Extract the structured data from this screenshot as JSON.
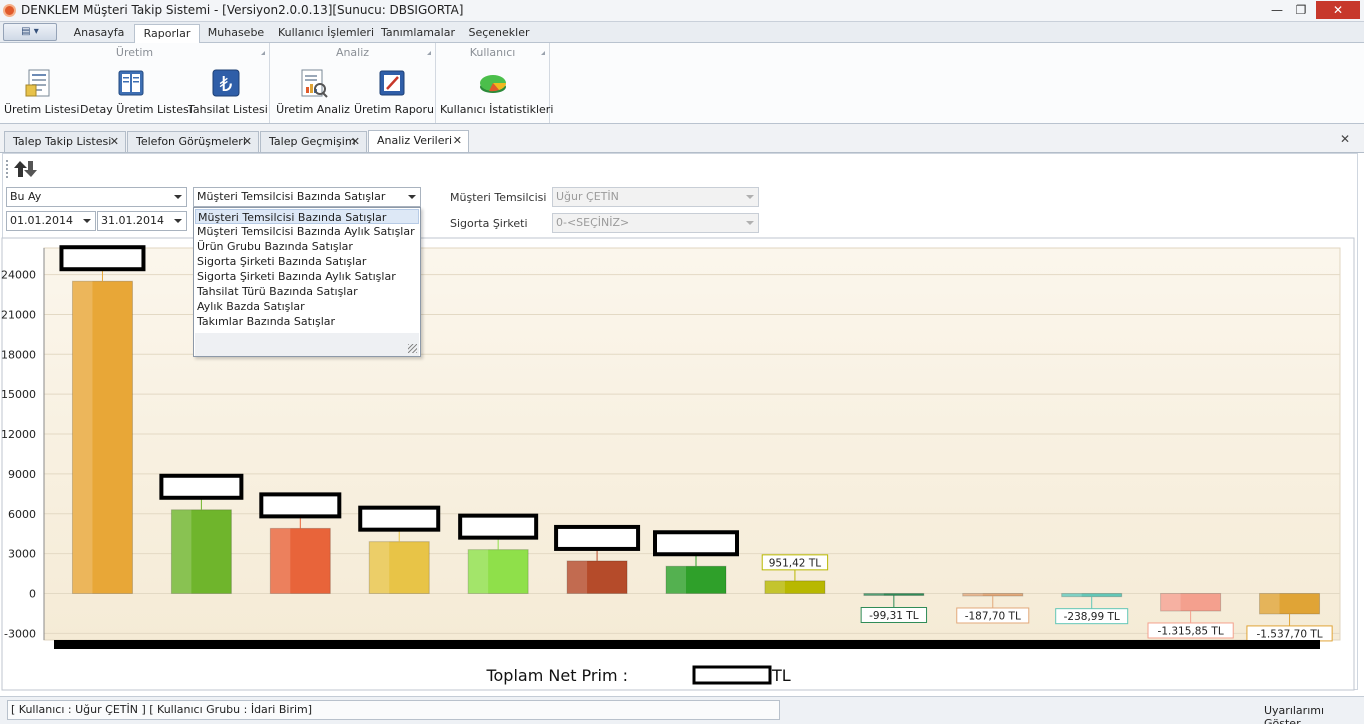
{
  "window": {
    "title": "DENKLEM Müşteri Takip Sistemi - [Versiyon2.0.0.13][Sunucu: DBSIGORTA]",
    "minimize_glyph": "—",
    "maximize_glyph": "❐",
    "close_glyph": "✕"
  },
  "ribbon": {
    "app_menu_glyph": "▤ ▾",
    "tabs": [
      "Anasayfa",
      "Raporlar",
      "Muhasebe",
      "Kullanıcı İşlemleri",
      "Tanımlamalar",
      "Seçenekler"
    ],
    "active_tab": "Raporlar",
    "groups": [
      {
        "title": "Üretim",
        "buttons": [
          {
            "label": "Üretim Listesi",
            "icon": "document-list-icon"
          },
          {
            "label": "Detay Üretim Listesi",
            "icon": "detail-document-icon"
          },
          {
            "label": "Tahsilat Listesi",
            "icon": "lira-icon"
          }
        ]
      },
      {
        "title": "Analiz",
        "buttons": [
          {
            "label": "Üretim Analiz",
            "icon": "analysis-report-icon"
          },
          {
            "label": "Üretim Raporu",
            "icon": "report-pen-icon"
          }
        ]
      },
      {
        "title": "Kullanıcı",
        "buttons": [
          {
            "label": "Kullanıcı İstatistikleri",
            "icon": "pie-chart-icon"
          }
        ]
      }
    ]
  },
  "doc_tabs": [
    {
      "label": "Talep Takip Listesi"
    },
    {
      "label": "Telefon Görüşmeleri"
    },
    {
      "label": "Talep Geçmişim"
    },
    {
      "label": "Analiz Verileri"
    }
  ],
  "doc_tab_close_glyph": "✕",
  "filters": {
    "period": "Bu Ay",
    "date_from": "01.01.2014",
    "date_to": "31.01.2014",
    "report_type": "Müşteri Temsilcisi Bazında Satışlar",
    "rep_label": "Müşteri Temsilcisi",
    "rep_value": "Uğur ÇETİN",
    "company_label": "Sigorta Şirketi",
    "company_value": "0-<SEÇİNİZ>"
  },
  "report_type_options": [
    "Müşteri Temsilcisi Bazında Satışlar",
    "Müşteri Temsilcisi Bazında Aylık Satışlar",
    "Ürün Grubu Bazında Satışlar",
    "Sigorta Şirketi Bazında Satışlar",
    "Sigorta Şirketi Bazında Aylık Satışlar",
    "Tahsilat Türü Bazında Satışlar",
    "Aylık Bazda Satışlar",
    "Takımlar Bazında Satışlar"
  ],
  "chart_data": {
    "type": "bar",
    "y_ticks": [
      "24000",
      "21000",
      "18000",
      "15000",
      "12000",
      "9000",
      "6000",
      "3000",
      "0",
      "-3000"
    ],
    "ylim": [
      -3500,
      26000
    ],
    "values": [
      23500,
      6300,
      4900,
      3900,
      3300,
      2450,
      2050,
      951.42,
      -99.31,
      -187.7,
      -238.99,
      -1315.85,
      -1537.7
    ],
    "data_labels": [
      "",
      "",
      "",
      "",
      "",
      "",
      "",
      "951,42 TL",
      "-99,31 TL",
      "-187,70 TL",
      "-238,99 TL",
      "-1.315,85 TL",
      "-1.537,70 TL"
    ],
    "colors": [
      "#e8a737",
      "#6fb52c",
      "#e8643a",
      "#e8c447",
      "#8fe04a",
      "#b54b2a",
      "#2fa02a",
      "#b8b800",
      "#2e8b57",
      "#e3a97b",
      "#63c7b7",
      "#f4a08e",
      "#e0a436"
    ],
    "grid": true,
    "legend": "none"
  },
  "total": {
    "label": "Toplam Net Prim :",
    "currency": "TL"
  },
  "statusbar": {
    "user_info": "[ Kullanıcı : Uğur ÇETİN ] [ Kullanıcı Grubu : İdari Birim]",
    "warnings_link": "Uyarılarımı Göster"
  }
}
